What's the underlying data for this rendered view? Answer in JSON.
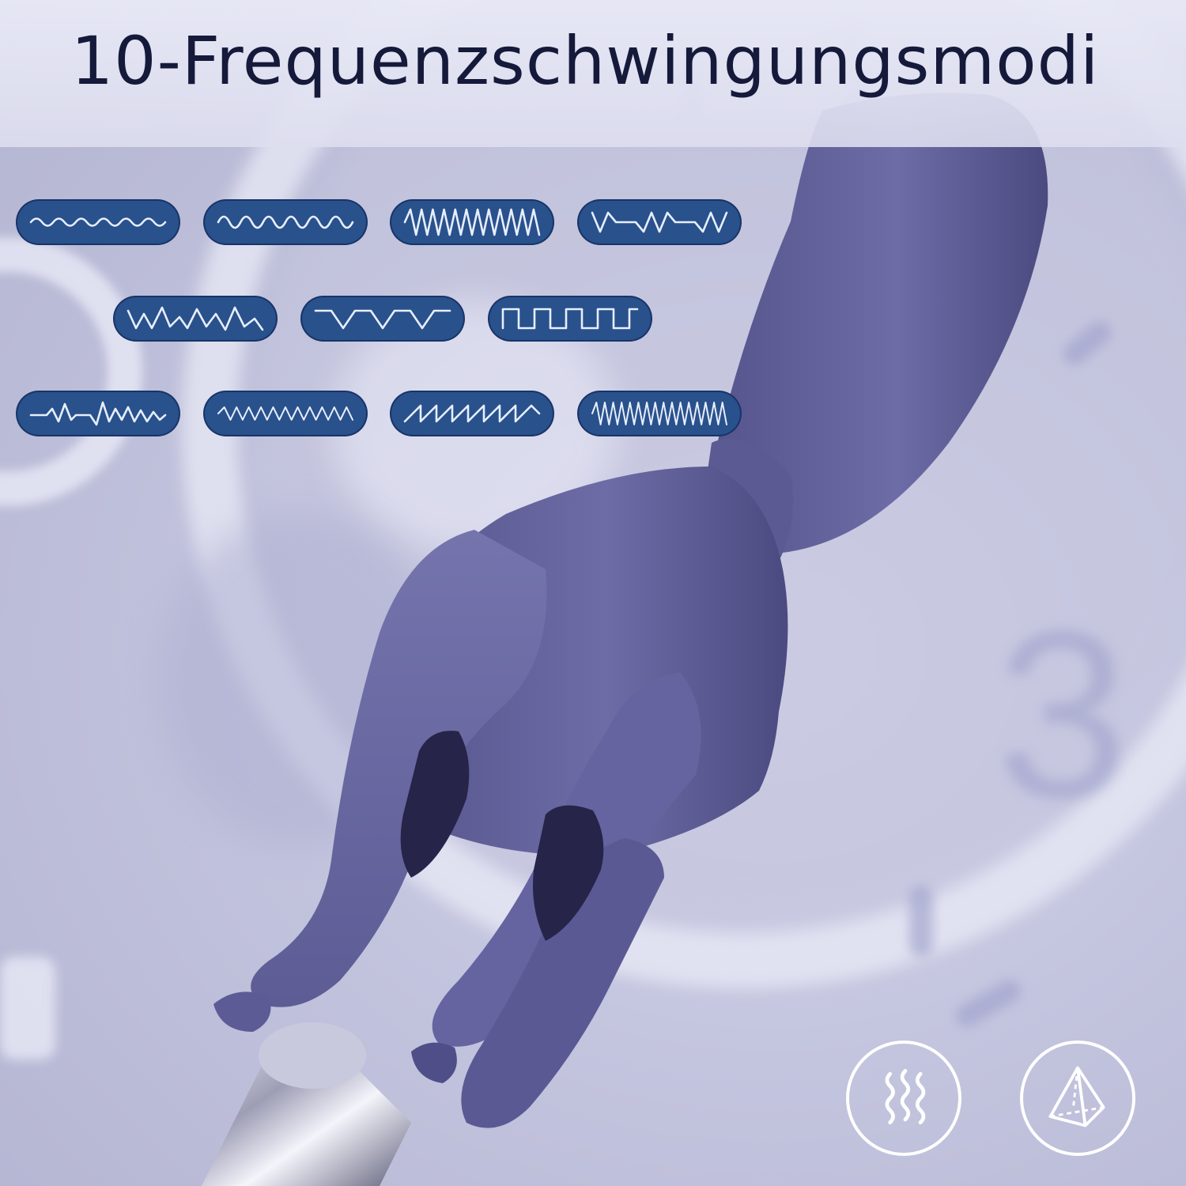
{
  "title": "10-Frequenzschwingungsmodi",
  "colors": {
    "title_text": "#15193a",
    "pill_fill": "#29518c",
    "pill_wave_stroke": "#e7eefc",
    "product_color": "#6d6ca6",
    "badge_stroke": "#ffffff"
  },
  "vibration_patterns": [
    {
      "name": "low-smooth-wave-icon"
    },
    {
      "name": "medium-smooth-wave-icon"
    },
    {
      "name": "dense-sharp-wave-icon"
    },
    {
      "name": "pulse-gap-wave-icon"
    },
    {
      "name": "irregular-peak-wave-icon"
    },
    {
      "name": "valley-wave-icon"
    },
    {
      "name": "square-wave-icon"
    },
    {
      "name": "heartbeat-wave-icon"
    },
    {
      "name": "tight-zigzag-wave-icon"
    },
    {
      "name": "sawtooth-wave-icon"
    },
    {
      "name": "high-frequency-wave-icon"
    }
  ],
  "feature_badges": [
    {
      "name": "vibration-waves-icon"
    },
    {
      "name": "pyramid-icon"
    }
  ]
}
